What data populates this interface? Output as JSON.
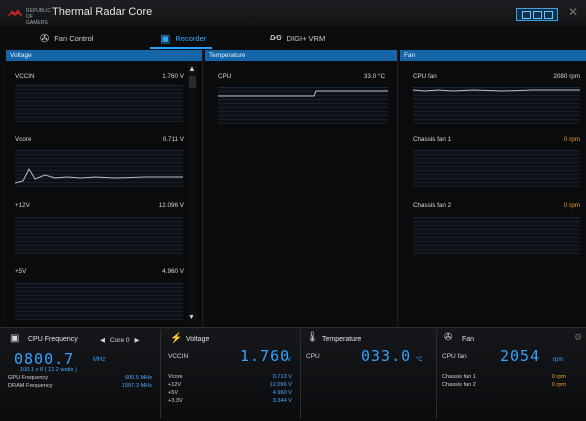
{
  "app": {
    "title": "Thermal Radar Core",
    "logo_text": "REPUBLIC OF GAMERS"
  },
  "tabs": [
    {
      "label": "Fan Control"
    },
    {
      "label": "Recorder"
    },
    {
      "label": "DIGI+ VRM"
    }
  ],
  "panels": {
    "voltage": {
      "header": "Voltage",
      "rows": [
        {
          "label": "VCCIN",
          "value": "1.760 V"
        },
        {
          "label": "Vcore",
          "value": "0.711 V"
        },
        {
          "label": "+12V",
          "value": "12.096 V"
        },
        {
          "label": "+5V",
          "value": "4.960 V"
        }
      ]
    },
    "temperature": {
      "header": "Temperature",
      "rows": [
        {
          "label": "CPU",
          "value": "33.0 °C"
        }
      ]
    },
    "fan": {
      "header": "Fan",
      "rows": [
        {
          "label": "CPU fan",
          "value": "2080 rpm"
        },
        {
          "label": "Chassis fan 1",
          "value": "0 rpm"
        },
        {
          "label": "Chassis fan 2",
          "value": "0 rpm"
        }
      ]
    }
  },
  "dashboard": {
    "cpu_freq": {
      "title": "CPU Frequency",
      "core_selector": "Core 0",
      "big_value": "0800.7",
      "unit": "MHz",
      "sub": "100.1  x  8   ( 12.2   watts )",
      "rows": [
        {
          "label": "GPU Frequency",
          "value": "600.5  MHz"
        },
        {
          "label": "DRAM Frequency",
          "value": "1597.3  MHz"
        }
      ]
    },
    "voltage": {
      "title": "Voltage",
      "big_label": "VCCIN",
      "big_value": "1.760",
      "unit": "V",
      "rows": [
        {
          "label": "Vcore",
          "value": "0.713  V"
        },
        {
          "label": "+12V",
          "value": "12.096  V"
        },
        {
          "label": "+5V",
          "value": "4.960  V"
        },
        {
          "label": "+3.3V",
          "value": "3.344  V"
        }
      ]
    },
    "temperature": {
      "title": "Temperature",
      "big_label": "CPU",
      "big_value": "033.0",
      "unit": "°C"
    },
    "fan": {
      "title": "Fan",
      "big_label": "CPU fan",
      "big_value": "2054",
      "unit": "rpm",
      "rows": [
        {
          "label": "Chassis fan 1",
          "value": "0  rpm"
        },
        {
          "label": "Chassis fan 2",
          "value": "0  rpm"
        }
      ]
    }
  },
  "colors": {
    "accent": "#1fa3ff",
    "header": "#1565a8",
    "warning": "#f0a21d"
  }
}
